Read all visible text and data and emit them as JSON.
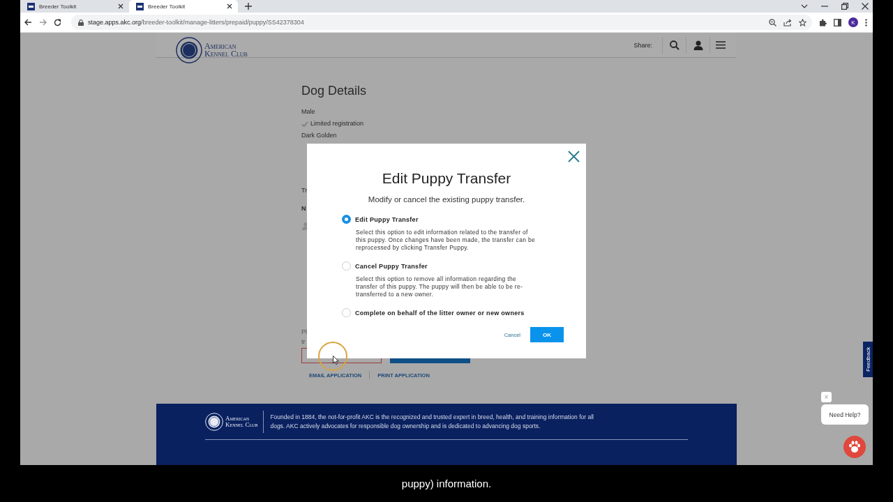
{
  "browser": {
    "tabs": [
      {
        "title": "Breeder Toolkit",
        "selected": false
      },
      {
        "title": "Breeder Toolkit",
        "selected": true
      }
    ],
    "url_host": "stage.apps.akc.org",
    "url_path": "/breeder-toolkit/manage-litters/prepaid/puppy/SS42378304",
    "avatar": "K"
  },
  "header": {
    "logo_line1": "American",
    "logo_line2": "Kennel Club",
    "share_label": "Share:"
  },
  "dog_details": {
    "heading": "Dog Details",
    "lines": [
      {
        "text": "Male",
        "checked": false
      },
      {
        "text": "Limited registration",
        "checked": true
      },
      {
        "text": "Dark Golden",
        "checked": false
      }
    ]
  },
  "hidden_section": {
    "line_1": "Tr",
    "line_2": "N",
    "note_1": "Pl",
    "note_2": "tr"
  },
  "links": [
    "EMAIL APPLICATION",
    "PRINT APPLICATION"
  ],
  "modal": {
    "title": "Edit Puppy Transfer",
    "subtitle": "Modify or cancel the existing puppy transfer.",
    "options": [
      {
        "label": "Edit Puppy Transfer",
        "description": "Select this option to edit information related to the transfer of this puppy. Once changes have been made, the transfer can be reprocessed by clicking Transfer Puppy.",
        "selected": true
      },
      {
        "label": "Cancel Puppy Transfer",
        "description": "Select this option to remove all information regarding the transfer of this puppy. The puppy will then be able to be re-transferred to a new owner.",
        "selected": false
      },
      {
        "label": "Complete on behalf of the litter owner or new owners",
        "selected": false
      }
    ],
    "cancel": "Cancel",
    "ok": "OK"
  },
  "footer": {
    "logo_line1": "American",
    "logo_line2": "Kennel Club",
    "text": "Founded in 1884, the not-for-profit AKC is the recognized and trusted expert in breed, health, and training information for all dogs. AKC actively advocates for responsible dog ownership and is dedicated to advancing dog sports."
  },
  "feedback": "Feedback",
  "chat": {
    "bubble": "Need Help?",
    "close": "×"
  },
  "caption": "puppy) information."
}
